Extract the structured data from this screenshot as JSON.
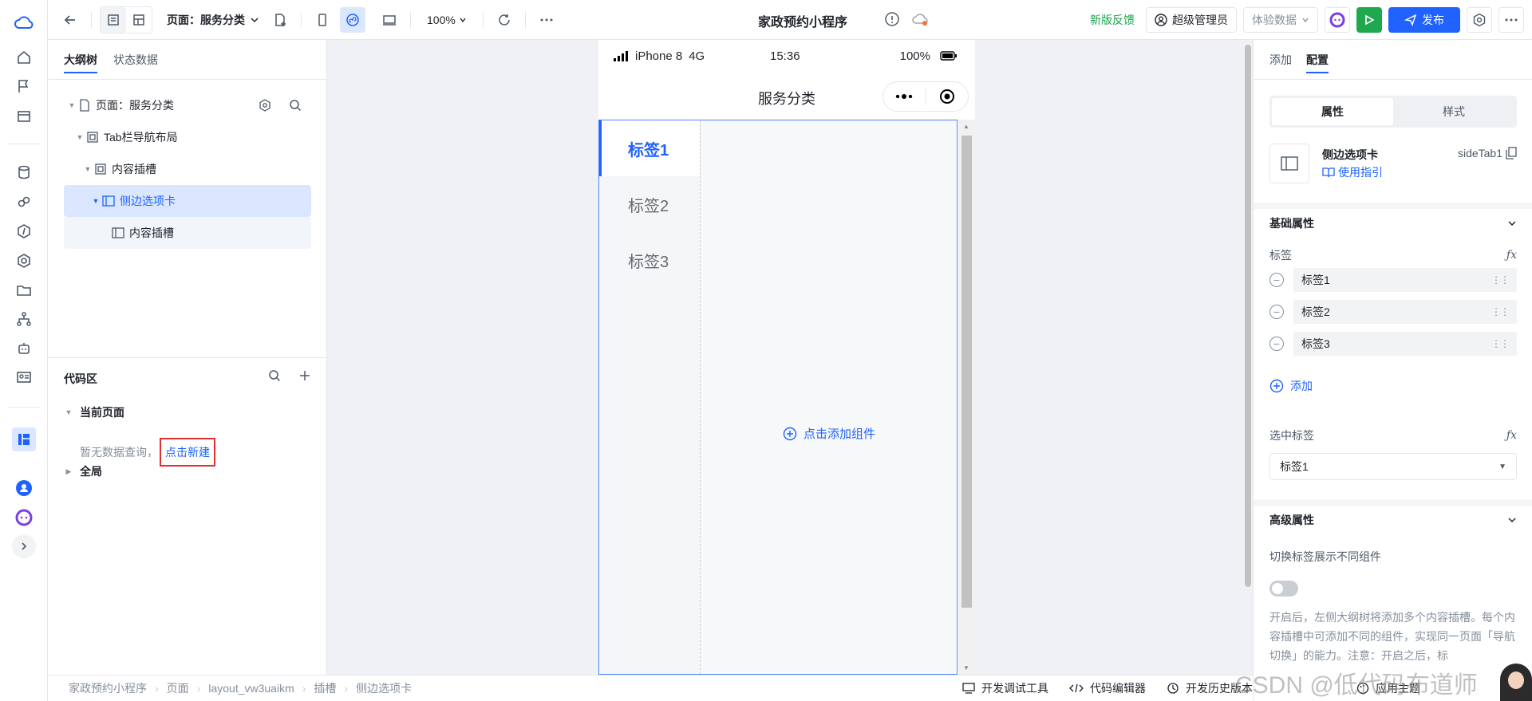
{
  "topbar": {
    "page_label": "页面：服务分类",
    "zoom": "100%",
    "app_title": "家政预约小程序",
    "feedback": "新版反馈",
    "admin": "超级管理员",
    "exp_data": "体验数据",
    "publish": "发布"
  },
  "left": {
    "tabs": [
      "大纲树",
      "状态数据"
    ],
    "tree": [
      {
        "label": "页面：服务分类"
      },
      {
        "label": "Tab栏导航布局"
      },
      {
        "label": "内容插槽"
      },
      {
        "label": "侧边选项卡"
      },
      {
        "label": "内容插槽"
      }
    ],
    "code": {
      "title": "代码区",
      "current_page": "当前页面",
      "empty": "暂无数据查询，",
      "new": "点击新建",
      "global": "全局"
    }
  },
  "phone": {
    "device": "iPhone 8",
    "network": "4G",
    "time": "15:36",
    "battery": "100%",
    "nav_title": "服务分类",
    "tabs": [
      "标签1",
      "标签2",
      "标签3"
    ],
    "add_component": "点击添加组件"
  },
  "right": {
    "tabs": [
      "添加",
      "配置"
    ],
    "seg": [
      "属性",
      "样式"
    ],
    "comp_name": "侧边选项卡",
    "comp_guide": "使用指引",
    "comp_id": "sideTab1",
    "basic_title": "基础属性",
    "tags_label": "标签",
    "fx": "ƒx",
    "tags": [
      "标签1",
      "标签2",
      "标签3"
    ],
    "add": "添加",
    "selected_label": "选中标签",
    "selected_value": "标签1",
    "advanced_title": "高级属性",
    "toggle_label": "切换标签展示不同组件",
    "toggle_on": false,
    "desc": "开启后，左侧大纲树将添加多个内容插槽。每个内容插槽中可添加不同的组件，实现同一页面「导航切换」的能力。注意：开启之后，标"
  },
  "bottom": {
    "crumbs": [
      "家政预约小程序",
      "页面",
      "layout_vw3uaikm",
      "插槽",
      "侧边选项卡"
    ],
    "tools": [
      "开发调试工具",
      "代码编辑器",
      "开发历史版本"
    ],
    "theme": "应用主题"
  },
  "watermark": "CSDN @低代码布道师",
  "colors": {
    "accent": "#1f62ff",
    "green": "#1fa84d",
    "highlight": "#e03131"
  }
}
